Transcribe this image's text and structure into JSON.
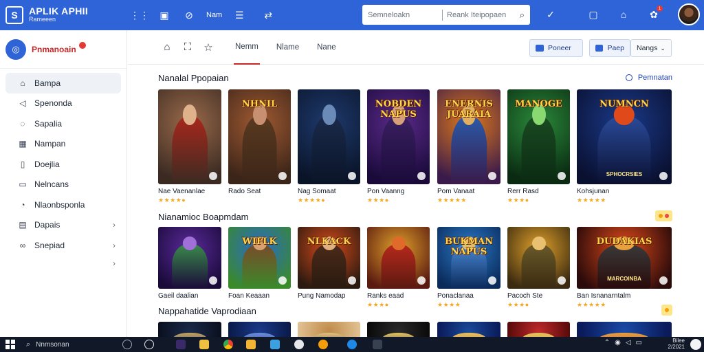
{
  "app": {
    "title": "APLIK APHII",
    "subtitle": "Rameeen"
  },
  "topbar": {
    "label": "Nam",
    "search_placeholder": "Semneloakn",
    "search_placeholder2": "Reank Iteipopaen",
    "notification_count": "1"
  },
  "sidebar": {
    "profile_name": "Pnmanoain",
    "items": [
      {
        "label": "Bampa",
        "icon": "home-icon"
      },
      {
        "label": "Spenonda",
        "icon": "speaker-icon"
      },
      {
        "label": "Sapalia",
        "icon": "chat-icon"
      },
      {
        "label": "Nampan",
        "icon": "grid-icon"
      },
      {
        "label": "Doejlia",
        "icon": "document-icon"
      },
      {
        "label": "Nelncans",
        "icon": "folder-icon"
      },
      {
        "label": "Nlaonbsponla",
        "icon": "chat-bubble-icon"
      },
      {
        "label": "Dapais",
        "icon": "image-icon"
      },
      {
        "label": "Snepiad",
        "icon": "link-icon"
      }
    ]
  },
  "toolbar": {
    "tabs": [
      "Nemm",
      "Nlame",
      "Nane"
    ],
    "active_tab": 0,
    "button1": "Poneer",
    "button2": "Paep",
    "select_value": "Nangs"
  },
  "sections": [
    {
      "title": "Nanalal Ppopaian",
      "link": "Pemnatan",
      "cards": [
        {
          "title": "Nae Vaenanlae",
          "stars": "★★★★●",
          "art": "",
          "sub": "",
          "colors": [
            "#9a6a4a",
            "#3a2a22",
            "#a8281c",
            "#e0b28c"
          ]
        },
        {
          "title": "Rado Seat",
          "stars": "",
          "art": "NHNIL",
          "sub": "",
          "colors": [
            "#a05a32",
            "#3b2418",
            "#5a3a20",
            "#c89070"
          ]
        },
        {
          "title": "Nag Somaat",
          "stars": "★★★★●",
          "art": "",
          "sub": "",
          "colors": [
            "#1e3a6e",
            "#0a1428",
            "#1a2a4a",
            "#6a8ab8"
          ]
        },
        {
          "title": "Pon Vaanng",
          "stars": "★★★●",
          "art": "NOBDEN NAPUS",
          "sub": "",
          "colors": [
            "#5b2a8a",
            "#1a0a3a",
            "#3a2060",
            "#d8a078"
          ]
        },
        {
          "title": "Pom Vanaat",
          "stars": "★★★★★",
          "art": "ENERNIS JUARAIA",
          "sub": "",
          "colors": [
            "#e07a1a",
            "#3a1a4a",
            "#2a5aa8",
            "#e0b060"
          ]
        },
        {
          "title": "Rerr Rasd",
          "stars": "★★★●",
          "art": "MANOGE",
          "sub": "",
          "colors": [
            "#2a8a3a",
            "#0a2a12",
            "#1a4a22",
            "#8ad870"
          ]
        },
        {
          "title": "Kohsjunan",
          "stars": "★★★★★",
          "art": "NUMNCN",
          "sub": "SPHOCRSIES",
          "colors": [
            "#1a3a8a",
            "#0a1030",
            "#2a4a9a",
            "#e04a1a"
          ]
        }
      ]
    },
    {
      "title": "Nianamioc Boapmdam",
      "pill": "",
      "cards": [
        {
          "title": "Gaeil daalian",
          "stars": "",
          "art": "",
          "sub": "",
          "colors": [
            "#5a2a9a",
            "#1a0a3a",
            "#3a8a4a",
            "#a070d8"
          ]
        },
        {
          "title": "Foan Keaaan",
          "stars": "",
          "art": "WIFLK",
          "sub": "",
          "colors": [
            "#2a6ac8",
            "#3a8a2a",
            "#7a4a2a",
            "#d8a070"
          ]
        },
        {
          "title": "Pung Namodap",
          "stars": "",
          "art": "NLKACK",
          "sub": "",
          "colors": [
            "#d84a1a",
            "#2a1a10",
            "#4a2a1a",
            "#e0b080"
          ]
        },
        {
          "title": "Ranks eaad",
          "stars": "★★★●",
          "art": "",
          "sub": "",
          "colors": [
            "#e0a02a",
            "#5a1a10",
            "#b8281c",
            "#e06a2a"
          ]
        },
        {
          "title": "Ponaclanaa",
          "stars": "★★★★",
          "art": "BUKMAN NAPUS",
          "sub": "",
          "colors": [
            "#2a7ac8",
            "#0a2a5a",
            "#4a8ad8",
            "#e0c070"
          ]
        },
        {
          "title": "Pacoch Ste",
          "stars": "★★★●",
          "art": "",
          "sub": "",
          "colors": [
            "#e0a02a",
            "#3a2a10",
            "#6a5a2a",
            "#e8c070"
          ]
        },
        {
          "title": "Ban Isnanarntalm",
          "stars": "★★★★★",
          "art": "DUDAKIAS",
          "sub": "MARCOINBA",
          "colors": [
            "#e04a1a",
            "#2a0a0a",
            "#3a3a3a",
            "#e8a040"
          ]
        }
      ]
    },
    {
      "title": "Nappahatide Vaprodiaan",
      "cards": [
        {
          "colors": [
            "#1a2a4a",
            "#0a1020",
            "#3a4a6a",
            "#c0a060"
          ]
        },
        {
          "colors": [
            "#1a3a8a",
            "#0a1a4a",
            "#2a4a9a",
            "#6a8ad8"
          ]
        },
        {
          "colors": [
            "#c08a4a",
            "#e0c090",
            "#6a4a2a",
            "#e0c080"
          ]
        },
        {
          "colors": [
            "#2a2a2a",
            "#0a0a0a",
            "#4a4a4a",
            "#e0c060"
          ]
        },
        {
          "colors": [
            "#1a4a9a",
            "#0a1a5a",
            "#e0702a",
            "#e0c060"
          ]
        },
        {
          "colors": [
            "#c02a2a",
            "#5a0a0a",
            "#e0a02a",
            "#e0c060"
          ]
        },
        {
          "colors": [
            "#1a4aa8",
            "#0a1a5a",
            "#e04a2a",
            "#e0a040"
          ]
        }
      ]
    }
  ],
  "taskbar": {
    "search_text": "Nnmsonan",
    "time": "Bilee",
    "date": "2/2021"
  }
}
